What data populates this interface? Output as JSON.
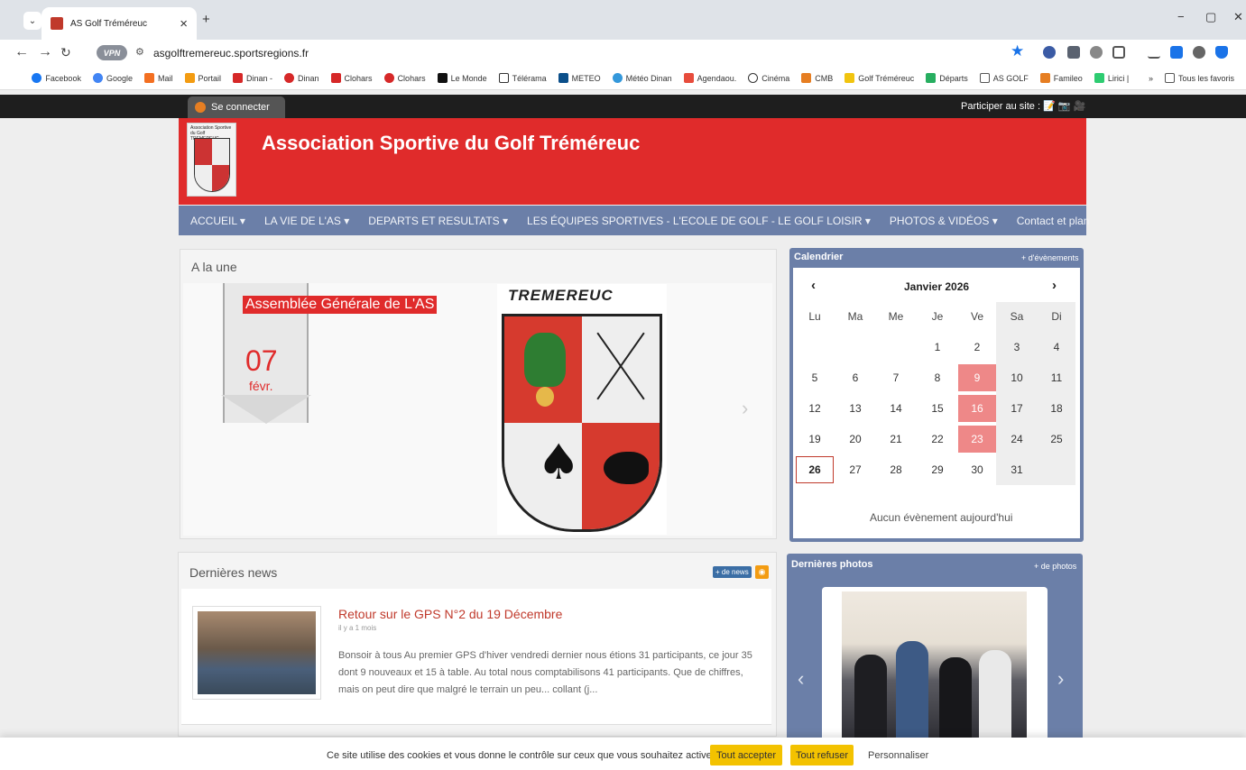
{
  "browser": {
    "tab_title": "AS Golf Tréméreuc",
    "tab_close": "×",
    "new_tab": "+",
    "tab_list": "⌄",
    "url": "asgolftremereuc.sportsregions.fr",
    "vpn_label": "VPN",
    "window_min": "−",
    "window_restore": "▢",
    "window_close": "✕",
    "bookmarks": [
      "Facebook",
      "Google",
      "Mail",
      "Portail",
      "Dinan -",
      "Dinan",
      "Clohars",
      "Clohars",
      "Le Monde",
      "Télérama",
      "METEO",
      "Météo Dinan",
      "Agendaou.",
      "Cinéma",
      "CMB",
      "Golf Tréméreuc",
      "Départs",
      "AS GOLF",
      "Famileo",
      "Lirici |"
    ],
    "bookmark_overflow": "»",
    "all_bookmarks": "Tous les favoris"
  },
  "site": {
    "login": "Se connecter",
    "participate": "Participer au site :",
    "participate_icons": "📝 📷 🎥",
    "title": "Association Sportive du Golf Tréméreuc",
    "logo_text": "Association Sportive du Golf TREMEREUC",
    "nav": [
      "ACCUEIL ▾",
      "LA VIE DE L'AS ▾",
      "DEPARTS ET RESULTATS ▾",
      "LES ÉQUIPES SPORTIVES - L'ECOLE DE GOLF - LE GOLF LOISIR ▾",
      "PHOTOS & VIDÉOS ▾",
      "Contact et plan"
    ]
  },
  "une": {
    "title": "A la une",
    "event_label": "Assemblée Générale de L'AS",
    "event_day": "07",
    "event_month": "févr.",
    "crest_title": "TREMEREUC",
    "next_arrow": "›"
  },
  "calendar": {
    "title": "Calendrier",
    "more": "+ d'évènements",
    "prev": "‹",
    "next": "›",
    "month": "Janvier 2026",
    "dow": [
      "Lu",
      "Ma",
      "Me",
      "Je",
      "Ve",
      "Sa",
      "Di"
    ],
    "days": [
      "1",
      "2",
      "3",
      "4",
      "5",
      "6",
      "7",
      "8",
      "9",
      "10",
      "11",
      "12",
      "13",
      "14",
      "15",
      "16",
      "17",
      "18",
      "19",
      "20",
      "21",
      "22",
      "23",
      "24",
      "25",
      "26",
      "27",
      "28",
      "29",
      "30",
      "31"
    ],
    "highlighted_days": [
      "9",
      "16",
      "23"
    ],
    "today": "26",
    "empty_message": "Aucun évènement aujourd'hui",
    "highlight_color": "#ee8888"
  },
  "news": {
    "title": "Dernières news",
    "more": "+ de news",
    "rss_icon": "rss-icon",
    "item_title": "Retour sur le GPS N°2 du 19 Décembre",
    "item_date": "il y a 1 mois",
    "item_text": "Bonsoir à tous Au premier GPS d'hiver vendredi dernier nous étions 31 participants, ce jour 35 dont 9 nouveaux et 15 à table. Au total nous comptabilisons 41 participants. Que de chiffres, mais on peut dire que malgré le terrain un peu... collant (j..."
  },
  "photos": {
    "title": "Dernières photos",
    "more": "+ de photos",
    "prev": "‹",
    "next": "›"
  },
  "cookie": {
    "text": "Ce site utilise des cookies et vous donne le contrôle sur ceux que vous souhaitez activer",
    "accept": "Tout accepter",
    "refuse": "Tout refuser",
    "customize": "Personnaliser"
  },
  "colors": {
    "header_red": "#e02b2b",
    "nav_blue": "#6b7fa8",
    "cookie_yellow": "#f3c200"
  }
}
